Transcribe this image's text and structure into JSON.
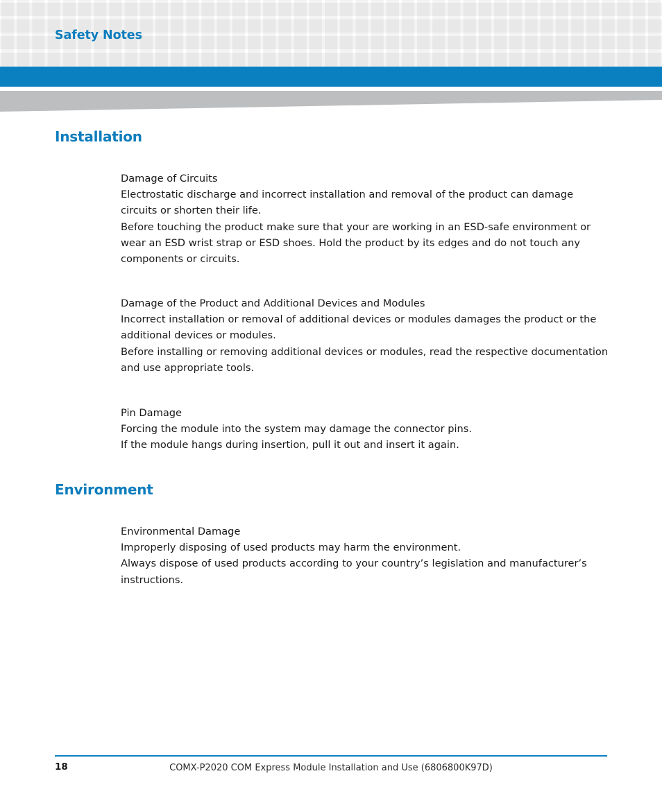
{
  "colors": {
    "accent_blue": "#0b80c1",
    "heading_blue": "#0d7dbd",
    "swoosh_gray": "#bcbec0",
    "grid_square_gray": "#f3f3f3",
    "body_text": "#1a1a1a"
  },
  "header": {
    "title": "Safety Notes"
  },
  "sections": [
    {
      "heading": "Installation",
      "blocks": [
        {
          "title": "Damage of Circuits",
          "lines": [
            "Electrostatic discharge and incorrect installation and removal of the product can damage circuits or shorten their life.",
            "Before touching the product make sure that your are working in an ESD-safe environment or wear an ESD wrist strap or ESD shoes. Hold the product by its edges and do not touch any components or circuits."
          ]
        },
        {
          "title": "Damage of the Product and Additional Devices and Modules",
          "lines": [
            "Incorrect installation or removal of additional devices or modules damages the product or the additional devices or modules.",
            "Before installing or removing additional devices or modules, read the respective documentation and use appropriate tools."
          ]
        },
        {
          "title": "Pin Damage",
          "lines": [
            "Forcing the module into the system may damage the connector pins.",
            "If the module hangs during insertion, pull it out and insert it again."
          ]
        }
      ]
    },
    {
      "heading": "Environment",
      "blocks": [
        {
          "title": "Environmental Damage",
          "lines": [
            "Improperly disposing of used products may harm the environment.",
            "Always dispose of used products according to your country’s legislation and manufacturer’s instructions."
          ]
        }
      ]
    }
  ],
  "footer": {
    "page_number": "18",
    "document_title": "COMX-P2020 COM Express Module Installation and Use (6806800K97D)"
  }
}
